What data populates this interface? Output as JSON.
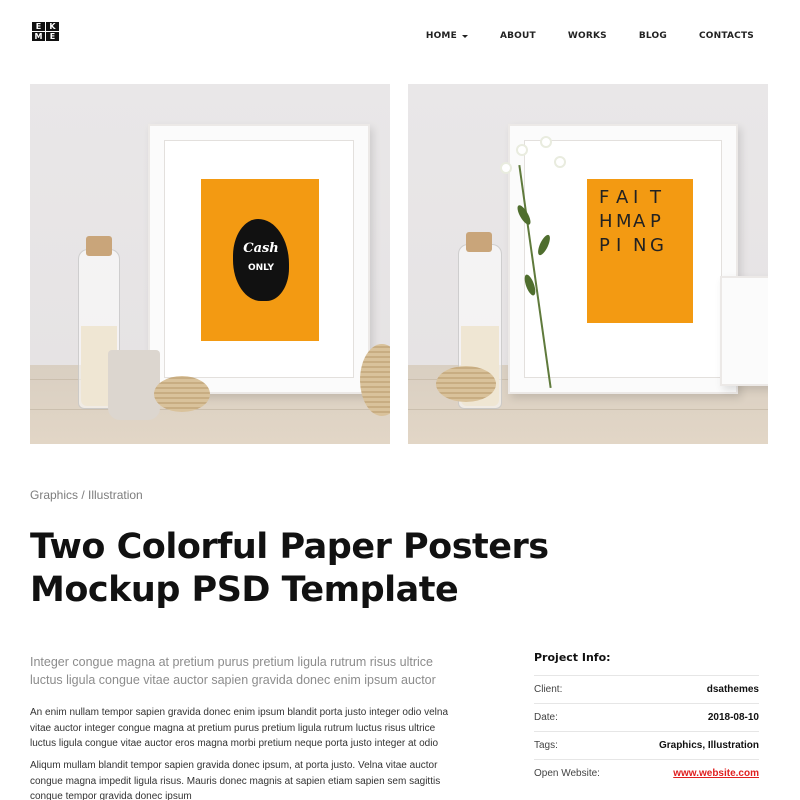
{
  "logo": {
    "letters": [
      "E",
      "K",
      "M",
      "E"
    ]
  },
  "nav": {
    "items": [
      {
        "label": "HOME",
        "has_dropdown": true
      },
      {
        "label": "ABOUT"
      },
      {
        "label": "WORKS"
      },
      {
        "label": "BLOG"
      },
      {
        "label": "CONTACTS"
      }
    ]
  },
  "gallery": {
    "left_poster": {
      "script": "Cash",
      "tag": "ONLY",
      "color": "#f39a12"
    },
    "right_poster": {
      "letters": [
        "F",
        "A",
        "I",
        "T",
        "H",
        "M",
        "A",
        "P",
        "P",
        "I",
        "N",
        "G"
      ],
      "color": "#f39a12"
    }
  },
  "project": {
    "category": "Graphics / Illustration",
    "title_line1": "Two Colorful Paper Posters",
    "title_line2": "Mockup PSD Template",
    "lead": "Integer congue magna at pretium purus pretium ligula rutrum risus ultrice luctus ligula congue vitae auctor sapien gravida donec enim ipsum auctor",
    "paragraph1": "An enim nullam tempor sapien gravida donec enim ipsum blandit porta justo integer odio velna vitae auctor integer congue magna at pretium purus pretium ligula rutrum luctus risus ultrice luctus ligula congue vitae auctor eros magna morbi pretium neque porta justo integer at odio",
    "paragraph2": "Aliqum mullam blandit tempor sapien gravida donec ipsum, at porta justo. Velna vitae auctor congue magna impedit ligula risus. Mauris donec magnis at sapien etiam sapien sem sagittis congue tempor gravida donec ipsum"
  },
  "info": {
    "heading": "Project Info:",
    "rows": [
      {
        "key": "Client:",
        "value": "dsathemes"
      },
      {
        "key": "Date:",
        "value": "2018-08-10"
      },
      {
        "key": "Tags:",
        "value": "Graphics, Illustration"
      },
      {
        "key": "Open Website:",
        "value": "www.website.com"
      }
    ],
    "link_color": "#e02020"
  }
}
